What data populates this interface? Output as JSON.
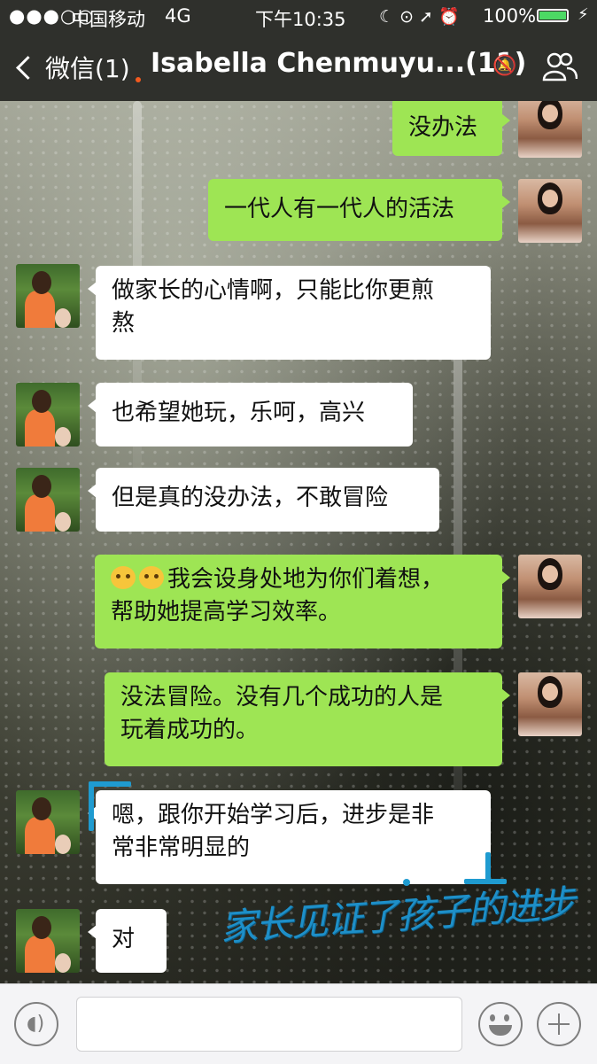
{
  "status_bar": {
    "signal": "●●●○○",
    "carrier": "中国移动",
    "network": "4G",
    "time": "下午10:35",
    "icons": "☾ ⊙ ➚ ⏰",
    "battery": "100%",
    "battery_color": "#4cd964"
  },
  "nav": {
    "back_label": "微信(1)",
    "title": "Isabella Chenmuyu...(11)",
    "mute_icon": "bell-muted-icon",
    "members_icon": "group-members-icon"
  },
  "messages": [
    {
      "sender": "me",
      "text": "没办法"
    },
    {
      "sender": "me",
      "text": "一代人有一代人的活法"
    },
    {
      "sender": "them",
      "line1": "做家长的心情啊，只能比你更煎",
      "line2": "熬"
    },
    {
      "sender": "them",
      "text": "也希望她玩，乐呵，高兴"
    },
    {
      "sender": "them",
      "text": "但是真的没办法，不敢冒险"
    },
    {
      "sender": "me",
      "line1": "我会设身处地为你们着想，",
      "line2": "帮助她提高学习效率。",
      "emoji": "smiling-faces-emoji"
    },
    {
      "sender": "me",
      "line1": "没法冒险。没有几个成功的人是",
      "line2": "玩着成功的。"
    },
    {
      "sender": "them",
      "line1": "嗯，跟你开始学习后，进步是非",
      "line2": "常非常明显的"
    },
    {
      "sender": "them",
      "text": "对"
    }
  ],
  "annotation": {
    "handwriting": "家长见证了孩子的进步",
    "color": "#1e8fc8"
  },
  "colors": {
    "me_bubble": "#9ee554",
    "them_bubble": "#ffffff",
    "bar": "#2f302c"
  }
}
